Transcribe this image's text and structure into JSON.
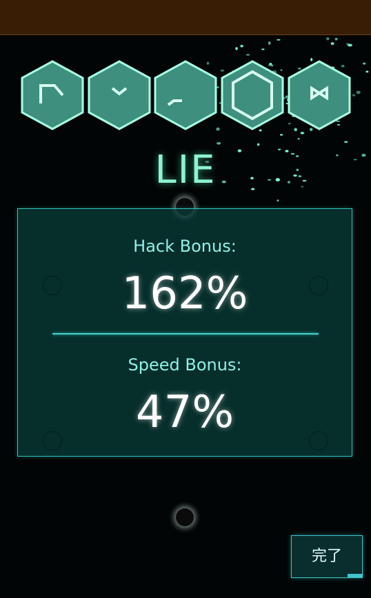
{
  "app": {
    "top_bar_color": "#3a1d05",
    "accent": "#3fc6cc"
  },
  "sequence": {
    "glyphs": [
      {
        "icon": "glyph-corner-icon"
      },
      {
        "icon": "glyph-chevron-icon"
      },
      {
        "icon": "glyph-slash-icon"
      },
      {
        "icon": "glyph-hexagon-icon"
      },
      {
        "icon": "glyph-bowtie-icon"
      }
    ],
    "word": "LIE"
  },
  "results": {
    "hack_bonus_label": "Hack Bonus:",
    "hack_bonus_value": "162%",
    "speed_bonus_label": "Speed Bonus:",
    "speed_bonus_value": "47%"
  },
  "actions": {
    "done_label": "完了"
  }
}
